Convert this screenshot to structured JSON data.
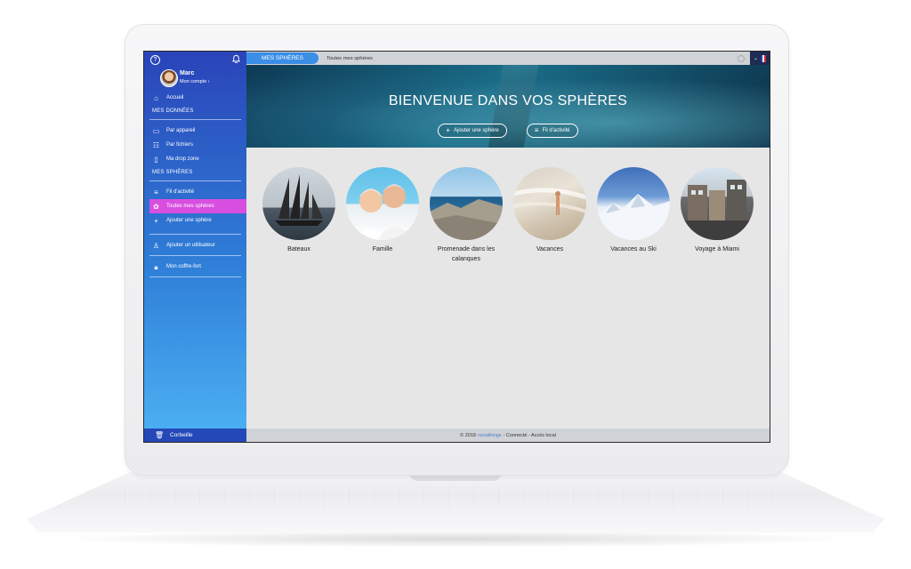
{
  "sidebar": {
    "user": {
      "name": "Marc",
      "account_label": "Mon compte"
    },
    "accueil": "Accueil",
    "section_data": "MES DONNÉES",
    "par_appareil": "Par appareil",
    "par_fichiers": "Par fichiers",
    "drop_zone": "Ma drop zone",
    "section_spheres": "MES SPHÈRES",
    "fil_activite": "Fil d'activité",
    "toutes_spheres": "Toutes mes sphères",
    "ajouter_sphere": "Ajouter une sphère",
    "ajouter_utilisateur": "Ajouter un utilisateur",
    "coffre_fort": "Mon coffre-fort",
    "corbeille": "Corbeille"
  },
  "topbar": {
    "tab_label": "MES SPHÈRES",
    "breadcrumb": "Toutes mes sphères"
  },
  "hero": {
    "title": "BIENVENUE DANS VOS SPHÈRES",
    "add_button": "Ajouter une sphère",
    "activity_button": "Fil d'activité"
  },
  "spheres": [
    {
      "label": "Bateaux"
    },
    {
      "label": "Famille"
    },
    {
      "label": "Promenade dans les calanques"
    },
    {
      "label": "Vacances"
    },
    {
      "label": "Vacances au Ski"
    },
    {
      "label": "Voyage à Miami"
    }
  ],
  "footer": {
    "copyright": "© 2018",
    "brand": "novathings",
    "status": "- Connecté - Accès local"
  },
  "colors": {
    "sidebar_top": "#2a44b9",
    "sidebar_bottom": "#4db2f4",
    "active_item": "#d84ee0",
    "tab_accent": "#3a8ee6"
  }
}
